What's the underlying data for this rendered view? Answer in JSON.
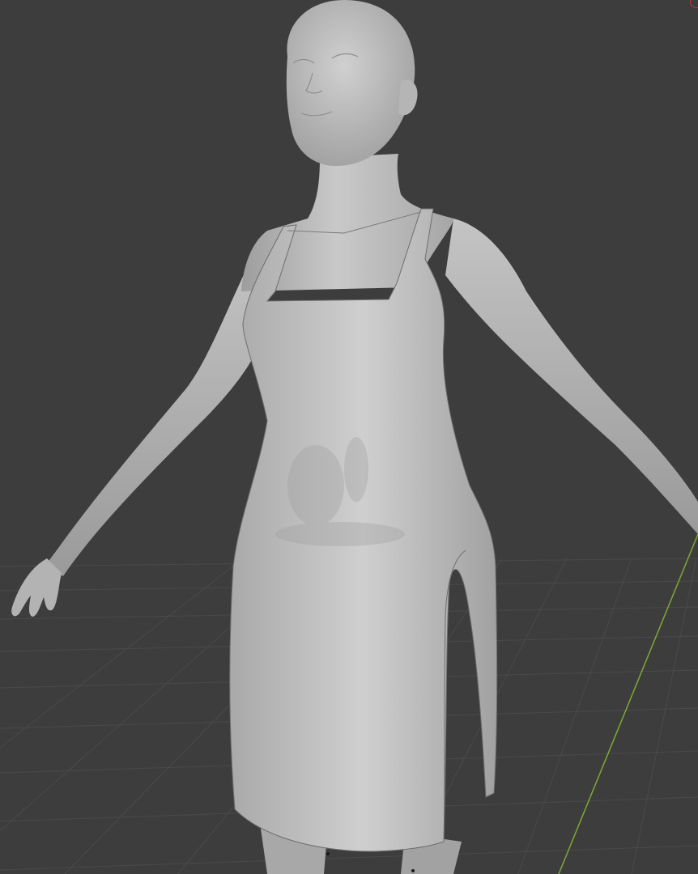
{
  "viewport": {
    "mode": "solid-shading",
    "background_color": "#3d3d3d",
    "grid_line_color": "#4a4a4a",
    "y_axis_color": "#7fa834",
    "object_color": "#bdbdbd",
    "gizmo_color": "#c0393b"
  },
  "scene": {
    "objects": [
      "human-body",
      "dress"
    ],
    "icons": [
      "view-gizmo-icon"
    ]
  }
}
